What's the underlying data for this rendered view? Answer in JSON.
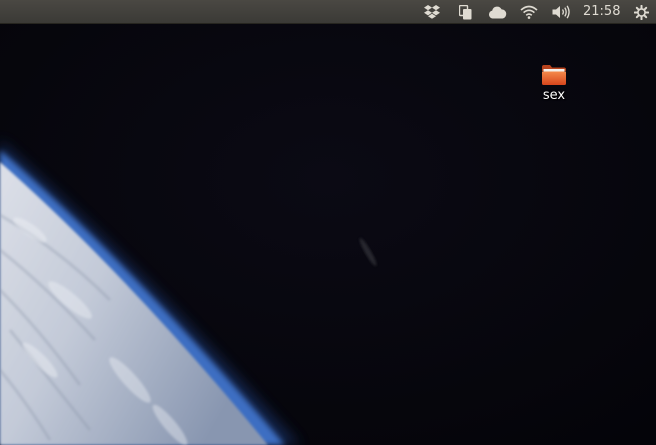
{
  "panel": {
    "clock": "21:58",
    "indicators": [
      "dropbox-icon",
      "clipboard-icon",
      "cloud-icon",
      "wifi-icon",
      "volume-icon",
      "power-icon"
    ]
  },
  "desktop": {
    "icons": [
      {
        "label": "sex",
        "icon": "folder-icon"
      }
    ]
  },
  "colors": {
    "panel": "#3c3b37",
    "panel_text": "#dfdbd2",
    "space": "#05050c",
    "atmosphere": "#4d80c8",
    "folder": "#e8622a"
  }
}
